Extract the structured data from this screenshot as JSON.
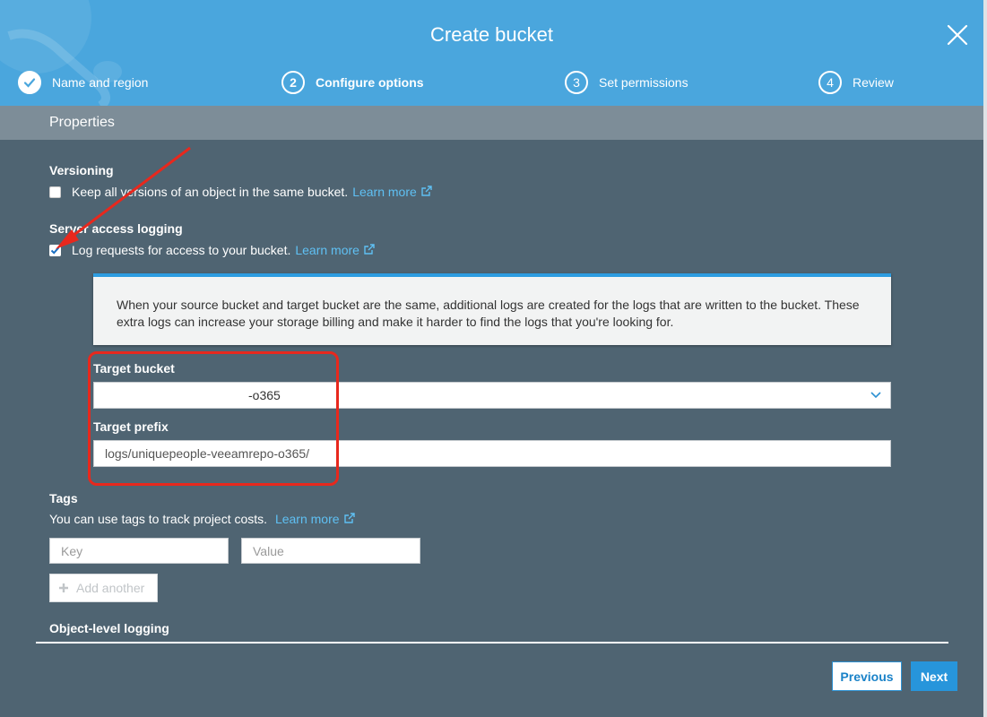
{
  "header": {
    "title": "Create bucket",
    "steps": [
      {
        "num": "",
        "label": "Name and region",
        "state": "done"
      },
      {
        "num": "2",
        "label": "Configure options",
        "state": "active"
      },
      {
        "num": "3",
        "label": "Set permissions",
        "state": "pending"
      },
      {
        "num": "4",
        "label": "Review",
        "state": "pending"
      }
    ]
  },
  "section": {
    "title": "Properties"
  },
  "versioning": {
    "label": "Versioning",
    "checkbox_text": "Keep all versions of an object in the same bucket.",
    "link": "Learn more",
    "checked": false
  },
  "logging": {
    "label": "Server access logging",
    "checkbox_text": "Log requests for access to your bucket.",
    "link": "Learn more",
    "checked": true,
    "info_text": "When your source bucket and target bucket are the same, additional logs are created for the logs that are written to the bucket. These extra logs can increase your storage billing and make it harder to find the logs that you're looking for.",
    "target_bucket_label": "Target bucket",
    "target_bucket_value": "-o365",
    "target_prefix_label": "Target prefix",
    "target_prefix_value": "logs/uniquepeople-veeamrepo-o365/"
  },
  "tags": {
    "label": "Tags",
    "description": "You can use tags to track project costs.",
    "link": "Learn more",
    "key_placeholder": "Key",
    "value_placeholder": "Value",
    "add_label": "Add another"
  },
  "object_logging": {
    "label": "Object-level logging"
  },
  "footer": {
    "previous": "Previous",
    "next": "Next"
  },
  "colors": {
    "accent": "#4aa6dd",
    "annotation": "#e8281d",
    "link": "#5fc0f3"
  }
}
